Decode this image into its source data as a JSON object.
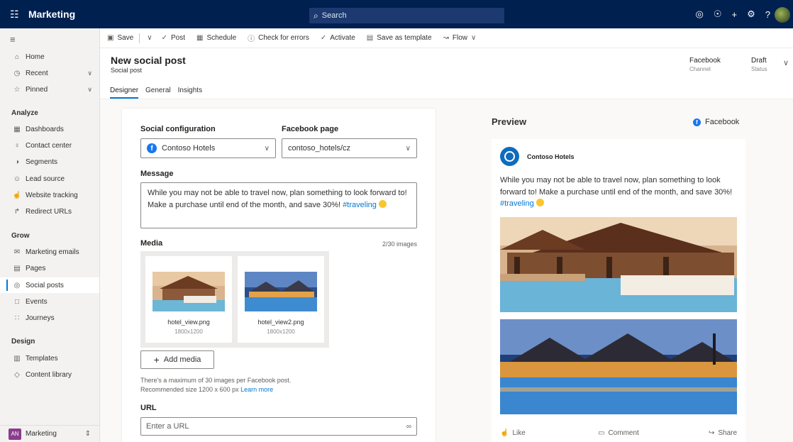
{
  "topbar": {
    "app_name": "Marketing",
    "search_placeholder": "Search",
    "icons": [
      "target-icon",
      "lightbulb-icon",
      "plus-icon",
      "gear-icon",
      "help-icon",
      "avatar"
    ]
  },
  "sidebar": {
    "items_top": [
      {
        "label": "Home",
        "icon": "home-icon"
      },
      {
        "label": "Recent",
        "icon": "clock-icon",
        "expandable": true
      },
      {
        "label": "Pinned",
        "icon": "pin-icon",
        "expandable": true
      }
    ],
    "groups": [
      {
        "title": "Analyze",
        "items": [
          {
            "label": "Dashboards",
            "icon": "dashboard-icon"
          },
          {
            "label": "Contact center",
            "icon": "person-icon"
          },
          {
            "label": "Segments",
            "icon": "segments-icon"
          },
          {
            "label": "Lead source",
            "icon": "lead-icon"
          },
          {
            "label": "Website tracking",
            "icon": "touch-icon"
          },
          {
            "label": "Redirect URLs",
            "icon": "redirect-icon"
          }
        ]
      },
      {
        "title": "Grow",
        "items": [
          {
            "label": "Marketing emails",
            "icon": "mail-icon"
          },
          {
            "label": "Pages",
            "icon": "page-icon"
          },
          {
            "label": "Social posts",
            "icon": "social-icon",
            "active": true
          },
          {
            "label": "Events",
            "icon": "calendar-icon"
          },
          {
            "label": "Journeys",
            "icon": "journey-icon"
          }
        ]
      },
      {
        "title": "Design",
        "items": [
          {
            "label": "Templates",
            "icon": "template-icon"
          },
          {
            "label": "Content library",
            "icon": "tag-icon"
          }
        ]
      }
    ],
    "area": {
      "badge": "AN",
      "label": "Marketing"
    }
  },
  "commandbar": {
    "save": "Save",
    "post": "Post",
    "schedule": "Schedule",
    "check_errors": "Check for errors",
    "activate": "Activate",
    "save_template": "Save as template",
    "flow": "Flow"
  },
  "record": {
    "title": "New social post",
    "entity": "Social post",
    "channel_value": "Facebook",
    "channel_label": "Channel",
    "status_value": "Draft",
    "status_label": "Status",
    "tabs": [
      "Designer",
      "General",
      "Insights"
    ],
    "active_tab": "Designer"
  },
  "form": {
    "social_config_label": "Social configuration",
    "social_config_value": "Contoso Hotels",
    "fb_page_label": "Facebook page",
    "fb_page_value": "contoso_hotels/cz",
    "message_label": "Message",
    "message_text": "While you may not be able to travel now, plan something to look forward to! Make a purchase until end of the month, and save 30%!",
    "message_hashtag": "#traveling",
    "media_label": "Media",
    "media_count": "2/30 images",
    "media": [
      {
        "name": "hotel_view.png",
        "dims": "1800x1200"
      },
      {
        "name": "hotel_view2.png",
        "dims": "1800x1200"
      }
    ],
    "add_media": "Add media",
    "help_line1": "There's a maximum of 30 images per Facebook post.",
    "help_line2": "Recommended size 1200 x 600 px",
    "learn_more": "Learn more",
    "url_label": "URL",
    "url_placeholder": "Enter a URL"
  },
  "preview": {
    "label": "Preview",
    "channel": "Facebook",
    "account": "Contoso Hotels",
    "text": "While you may not be able to travel now, plan something to look forward to! Make a purchase until end of the month, and save 30%!",
    "hashtag": "#traveling",
    "like": "Like",
    "comment": "Comment",
    "share": "Share"
  },
  "colors": {
    "topbar": "#002050",
    "accent": "#0078d4",
    "facebook": "#1877f2"
  }
}
